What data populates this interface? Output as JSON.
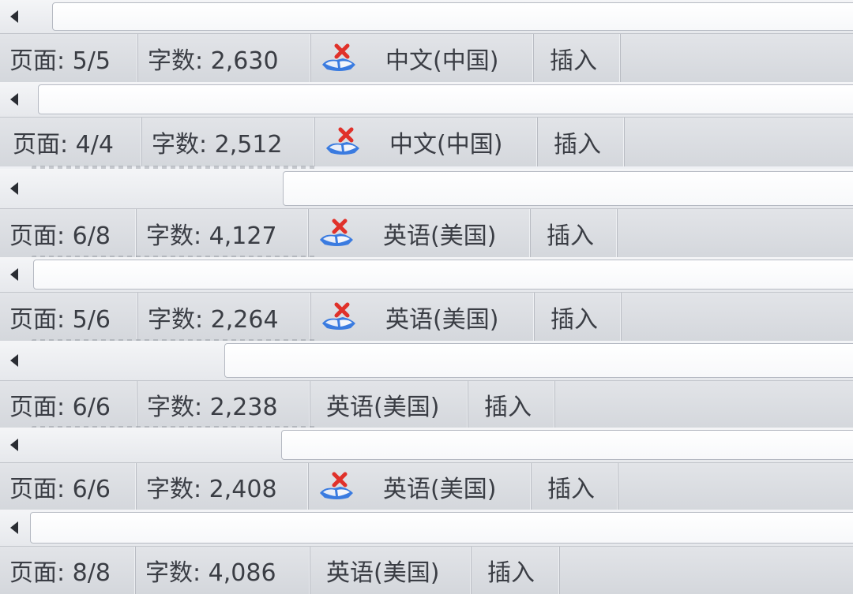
{
  "status_bars": [
    {
      "page_label": "页面: 5/5",
      "word_count_label": "字数: 2,630",
      "proofing_icon": "spellcheck-error-icon",
      "language": "中文(中国)",
      "mode": "插入"
    },
    {
      "page_label": "页面: 4/4",
      "word_count_label": "字数: 2,512",
      "proofing_icon": "spellcheck-error-icon",
      "language": "中文(中国)",
      "mode": "插入"
    },
    {
      "page_label": "页面: 6/8",
      "word_count_label": "字数: 4,127",
      "proofing_icon": "spellcheck-error-icon",
      "language": "英语(美国)",
      "mode": "插入"
    },
    {
      "page_label": "页面: 5/6",
      "word_count_label": "字数: 2,264",
      "proofing_icon": "spellcheck-error-icon",
      "language": "英语(美国)",
      "mode": "插入"
    },
    {
      "page_label": "页面: 6/6",
      "word_count_label": "字数: 2,238",
      "proofing_icon": null,
      "language": "英语(美国)",
      "mode": "插入"
    },
    {
      "page_label": "页面: 6/6",
      "word_count_label": "字数: 2,408",
      "proofing_icon": "spellcheck-error-icon",
      "language": "英语(美国)",
      "mode": "插入"
    },
    {
      "page_label": "页面: 8/8",
      "word_count_label": "字数: 4,086",
      "proofing_icon": null,
      "language": "英语(美国)",
      "mode": "插入"
    }
  ],
  "scrollbars": [
    {
      "arrow_icon": "scroll-left-arrow-icon",
      "position": 0.06
    },
    {
      "arrow_icon": "scroll-left-arrow-icon",
      "position": 0.04
    },
    {
      "arrow_icon": "scroll-left-arrow-icon",
      "position": 0.33
    },
    {
      "arrow_icon": "scroll-left-arrow-icon",
      "position": 0.04
    },
    {
      "arrow_icon": "scroll-left-arrow-icon",
      "position": 0.26
    },
    {
      "arrow_icon": "scroll-left-arrow-icon",
      "position": 0.33
    },
    {
      "arrow_icon": "scroll-left-arrow-icon",
      "position": 0.03
    }
  ],
  "colors": {
    "statusbar_bg": "#d9dce1",
    "text": "#3a3d44",
    "icon_red": "#e0312a",
    "icon_blue": "#2f6fd0"
  }
}
